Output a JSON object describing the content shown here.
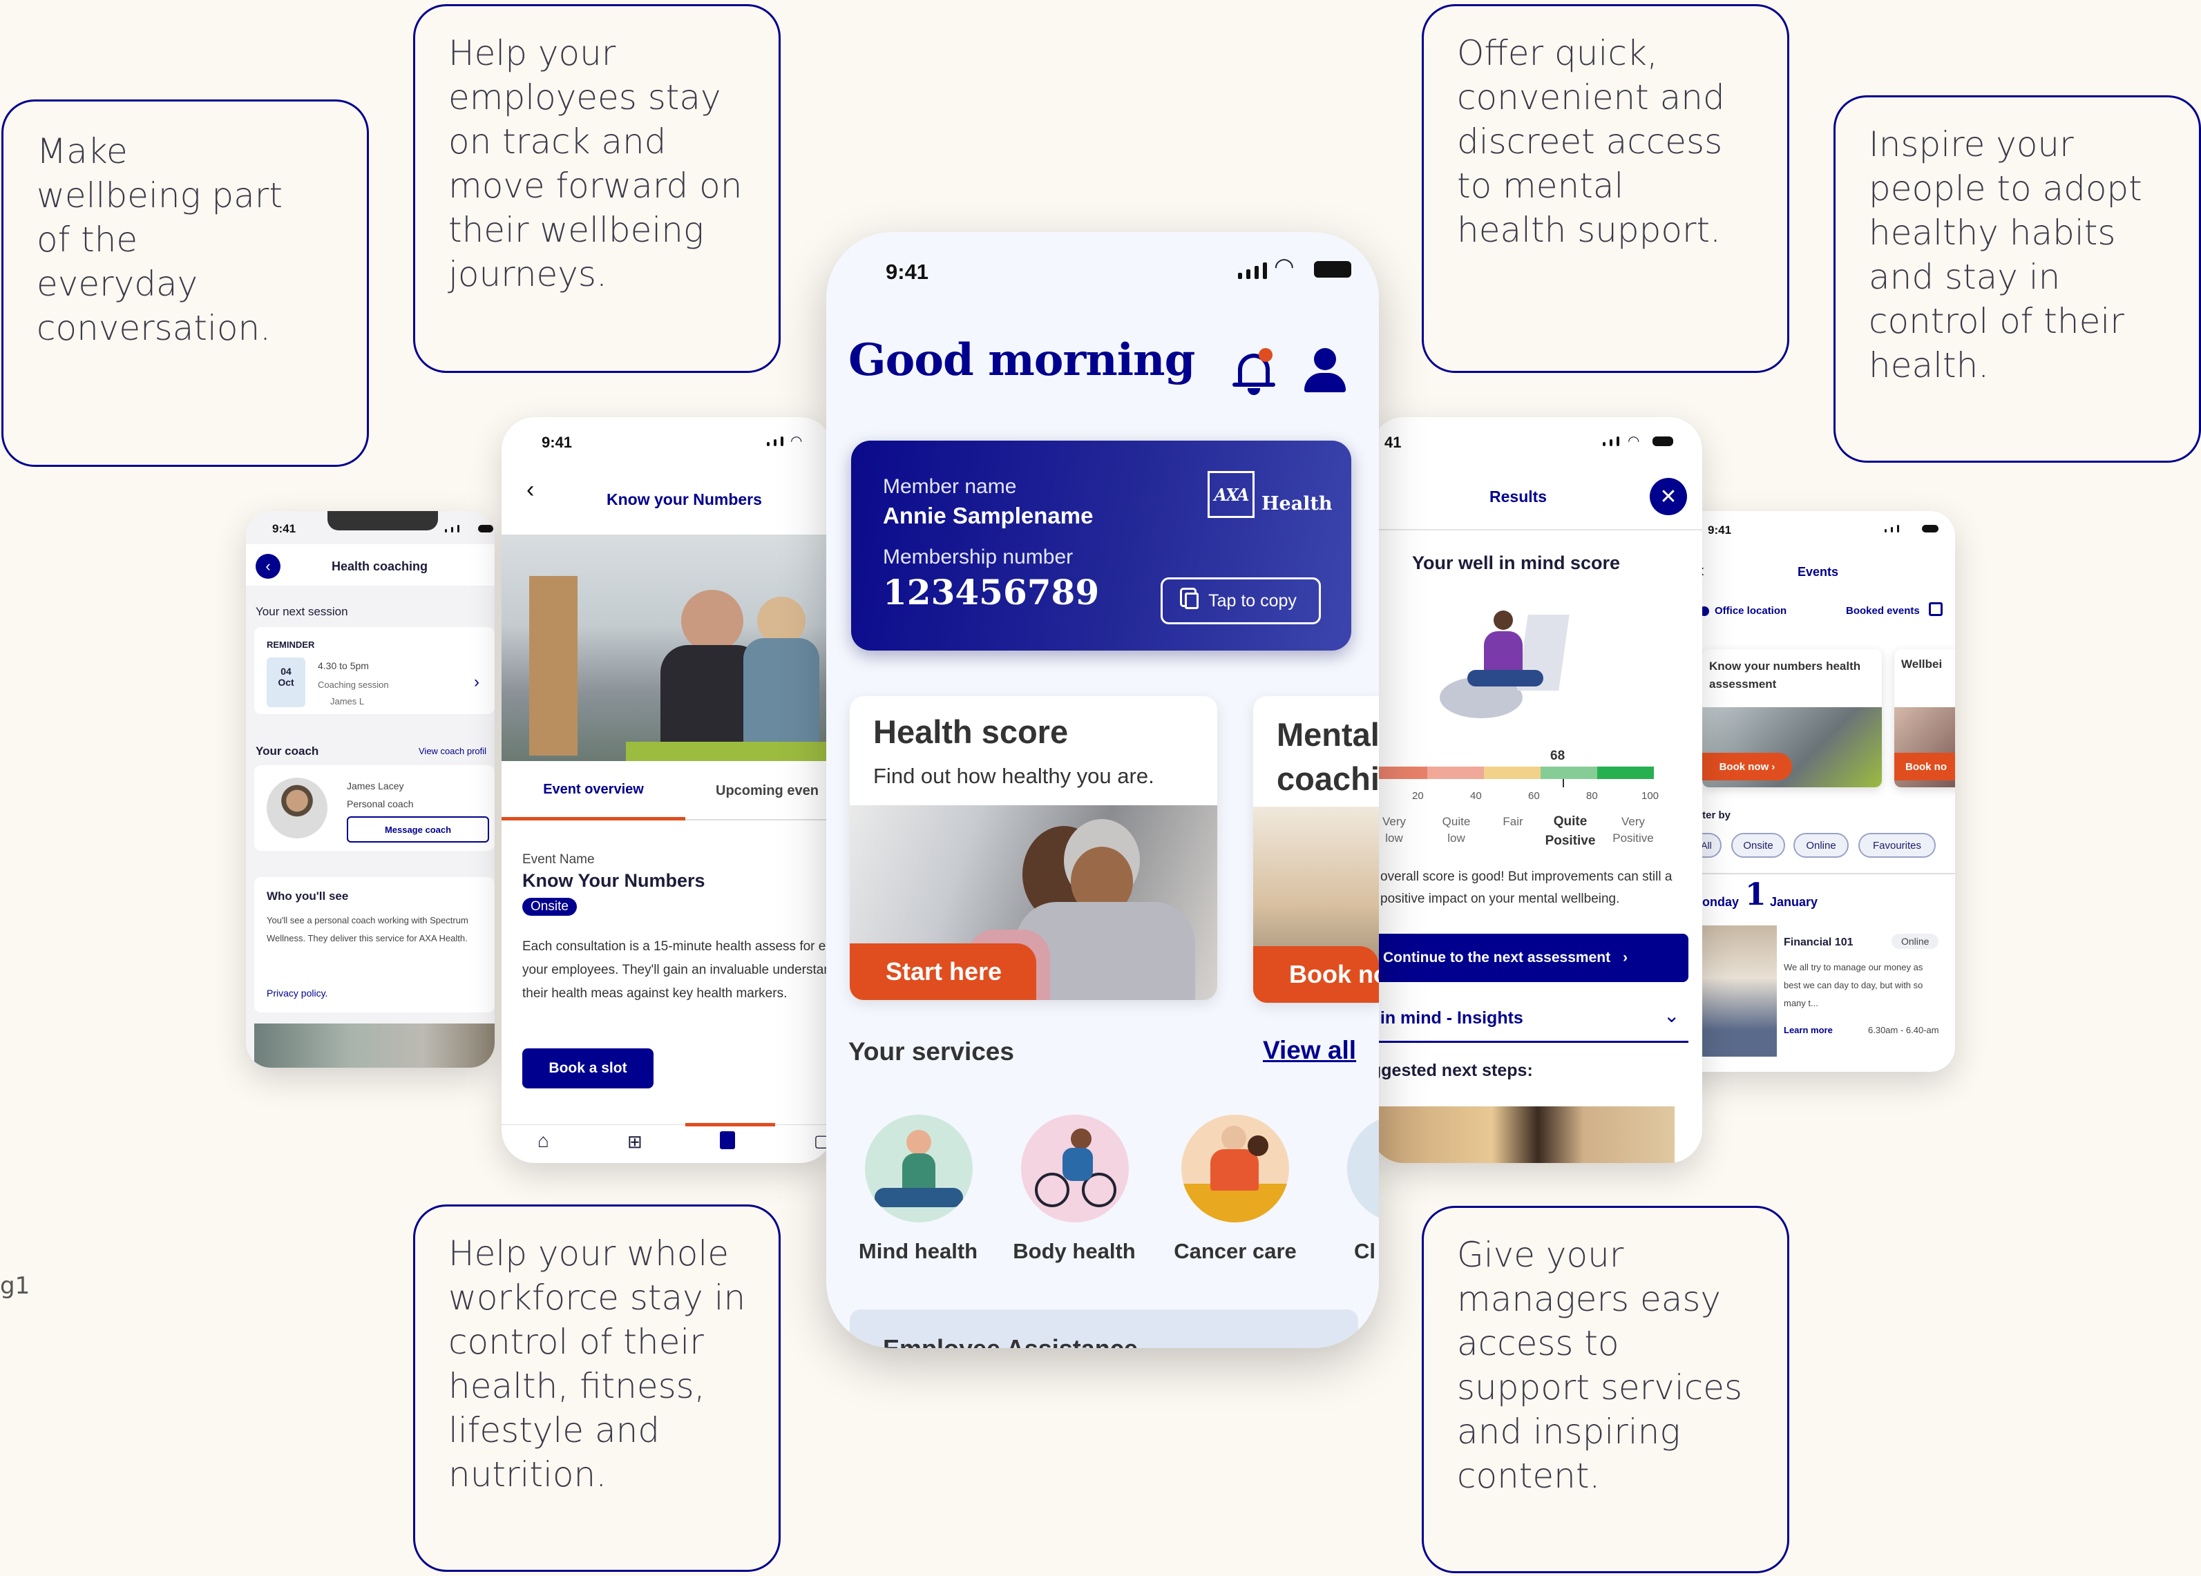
{
  "callouts": {
    "c1": "Make wellbeing part of the everyday conversation.",
    "c2": "Help your employees stay on track and move forward on their wellbeing journeys.",
    "c3": "Offer quick, convenient and discreet access to mental health support.",
    "c4": "Inspire your people to adopt healthy habits and stay in control of their health.",
    "c5": "Help your whole workforce stay in control of their health, fitness, lifestyle and nutrition.",
    "c6": "Give your managers easy access to support services and inspiring content."
  },
  "edge_note": "g1",
  "main_phone": {
    "time": "9:41",
    "greeting": "Good morning",
    "card": {
      "member_label": "Member name",
      "member_name": "Annie Samplename",
      "membership_label": "Membership number",
      "membership_number": "123456789",
      "brand": "AXA",
      "brand_suffix": "Health",
      "copy_button": "Tap to copy"
    },
    "health_score": {
      "title": "Health score",
      "subtitle": "Find out how healthy you are.",
      "cta": "Start here"
    },
    "mental_card": {
      "title_line1": "Mental",
      "title_line2": "coachi",
      "cta": "Book no"
    },
    "services": {
      "heading": "Your services",
      "view_all": "View all",
      "items": [
        "Mind health",
        "Body health",
        "Cancer care",
        "Cl"
      ]
    },
    "bottom_peek": "Employee Assistance"
  },
  "coaching_phone": {
    "time": "9:41",
    "title": "Health coaching",
    "next_session": "Your next session",
    "reminder": "REMINDER",
    "date_day": "04",
    "date_month": "Oct",
    "session_time": "4.30 to 5pm",
    "session_type": "Coaching session",
    "session_coach": "James L",
    "your_coach": "Your coach",
    "view_profile": "View coach profil",
    "coach_name": "James Lacey",
    "coach_role": "Personal coach",
    "message_button": "Message coach",
    "who_heading": "Who you'll see",
    "who_text": "You'll see a personal coach working with Spectrum Wellness. They deliver this service for AXA Health.",
    "privacy": "Privacy policy."
  },
  "numbers_phone": {
    "time": "9:41",
    "title": "Know your Numbers",
    "tab_overview": "Event overview",
    "tab_upcoming": "Upcoming even",
    "event_label": "Event Name",
    "event_name": "Know Your Numbers",
    "badge": "Onsite",
    "description": "Each consultation is a 15-minute health assess for each of your employees. They'll gain an invaluable understanding of their health meas against key health markers.",
    "book_button": "Book a slot"
  },
  "results_phone": {
    "time": "41",
    "title": "Results",
    "score_title": "Your well in mind score",
    "score_value": "68",
    "ticks": [
      "20",
      "40",
      "60",
      "80",
      "100"
    ],
    "bands": [
      "Very low",
      "Quite low",
      "Fair",
      "Quite Positive",
      "Very Positive"
    ],
    "summary": "overall score is good! But improvements can still a positive impact on your mental wellbeing.",
    "continue_button": "Continue to the next assessment",
    "insights": "l in mind - Insights",
    "next_steps": "ggested next steps:"
  },
  "events_phone": {
    "time": "9:41",
    "title": "Events",
    "office_location": "Office location",
    "booked_events": "Booked events",
    "card1_title": "Know your numbers health assessment",
    "card1_cta": "Book now",
    "card2_title": "Wellbei",
    "card2_cta": "Book no",
    "filter_label": "lter by",
    "filters": [
      "All",
      "Onsite",
      "Online",
      "Favourites"
    ],
    "date_weekday": "onday",
    "date_day": "1",
    "date_month": "January",
    "event_title": "Financial 101",
    "event_badge": "Online",
    "event_text": "We all try to manage our money as best we can day to day, but with so many t...",
    "learn_more": "Learn more",
    "event_time": "6.30am - 6.40-am"
  },
  "colors": {
    "navy": "#00008f",
    "orange": "#e04e1f",
    "background": "#fcf8f2"
  },
  "icons": [
    "bell-icon",
    "user-icon",
    "copy-icon",
    "back-icon",
    "close-icon",
    "home-icon",
    "grid-icon",
    "bookmark-icon",
    "calendar-icon",
    "chevron-right-icon",
    "chevron-down-icon",
    "location-icon",
    "signal-icon",
    "wifi-icon",
    "battery-icon"
  ]
}
